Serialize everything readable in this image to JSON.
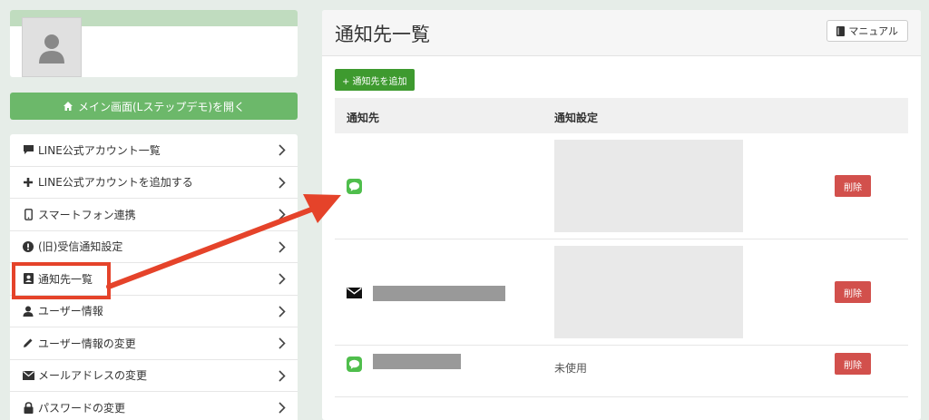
{
  "sidebar": {
    "open_main_label": "メイン画面(Lステップデモ)を開く",
    "items": [
      {
        "label": "LINE公式アカウント一覧",
        "icon": "comment-icon"
      },
      {
        "label": "LINE公式アカウントを追加する",
        "icon": "plus-icon"
      },
      {
        "label": "スマートフォン連携",
        "icon": "smartphone-icon"
      },
      {
        "label": "(旧)受信通知設定",
        "icon": "exclamation-icon"
      },
      {
        "label": "通知先一覧",
        "icon": "contact-card-icon"
      },
      {
        "label": "ユーザー情報",
        "icon": "user-icon"
      },
      {
        "label": "ユーザー情報の変更",
        "icon": "pencil-icon"
      },
      {
        "label": "メールアドレスの変更",
        "icon": "envelope-icon"
      },
      {
        "label": "パスワードの変更",
        "icon": "lock-icon"
      }
    ]
  },
  "main": {
    "title": "通知先一覧",
    "manual_label": "マニュアル",
    "add_label": "+ 通知先を追加",
    "table": {
      "columns": [
        "通知先",
        "通知設定"
      ],
      "rows": [
        {
          "type": "line",
          "setting": "",
          "delete_label": "削除"
        },
        {
          "type": "email",
          "setting": "",
          "delete_label": "削除"
        },
        {
          "type": "line",
          "setting": "未使用",
          "delete_label": "削除"
        }
      ]
    }
  },
  "colors": {
    "accent_green": "#6cb86a",
    "add_green": "#3e9a2f",
    "delete_red": "#d2504c",
    "highlight_red": "#e5432a",
    "line_green": "#4fbe4c"
  }
}
